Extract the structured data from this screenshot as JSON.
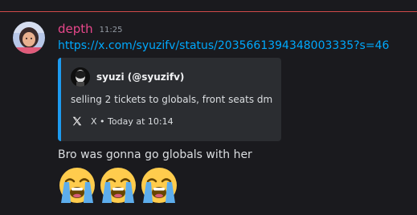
{
  "message": {
    "username": "depth",
    "timestamp": "11:25",
    "link": "https://x.com/syuzifv/status/2035661394348003335?s=46",
    "text": "Bro was gonna go globals with her",
    "emojis": [
      "loudly-crying-face",
      "loudly-crying-face",
      "loudly-crying-face"
    ]
  },
  "embed": {
    "author": "syuzi (@syuzifv)",
    "description": "selling 2 tickets to globals, front seats dm",
    "footer": "X • Today at 10:14",
    "accent_color": "#1d9bf0"
  },
  "colors": {
    "username": "#e8478b",
    "link": "#00a8fc",
    "divider": "#d14a4a",
    "background": "#1a1a1e",
    "embed_background": "#2b2d31"
  }
}
